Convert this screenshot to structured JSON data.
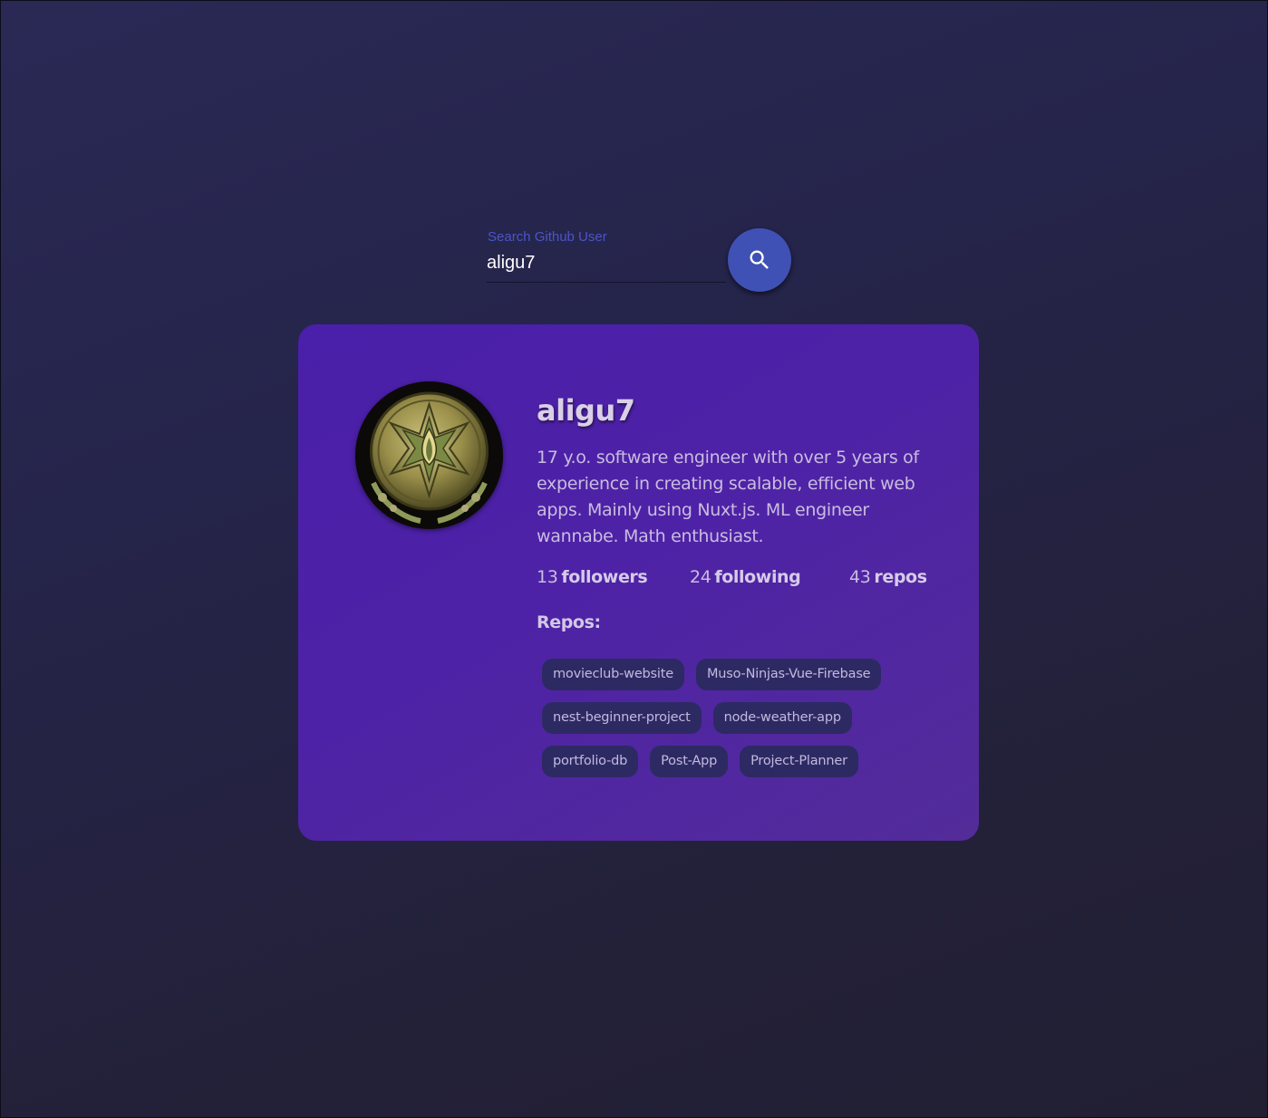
{
  "search": {
    "label": "Search Github User",
    "value": "aligu7",
    "button_icon": "search-icon"
  },
  "profile": {
    "username": "aligu7",
    "avatar_icon": "medal-emblem",
    "bio": "17 y.o. software engineer with over 5 years of experience in creating scalable, efficient web apps. Mainly using Nuxt.js. ML engineer wannabe. Math enthusiast.",
    "stats": {
      "followers_count": "13",
      "followers_label": "followers",
      "following_count": "24",
      "following_label": "following",
      "repos_count": "43",
      "repos_label": "repos"
    },
    "repos_title": "Repos:",
    "repos": [
      "movieclub-website",
      "Muso-Ninjas-Vue-Firebase",
      "nest-beginner-project",
      "node-weather-app",
      "portfolio-db",
      "Post-App",
      "Project-Planner"
    ]
  },
  "colors": {
    "accent": "#3f51b5",
    "card": "#4e22a6",
    "chip": "#2d2a63"
  }
}
